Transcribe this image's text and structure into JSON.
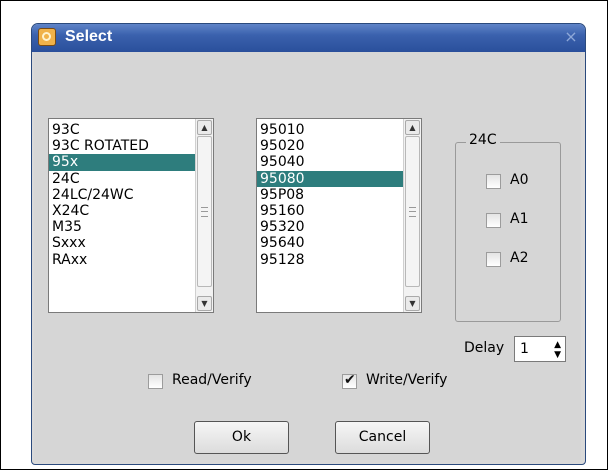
{
  "window": {
    "title": "Select",
    "close_symbol": "×"
  },
  "list_left": {
    "items": [
      "93C",
      "93C ROTATED",
      "95x",
      "24C",
      "24LC/24WC",
      "X24C",
      "M35",
      "Sxxx",
      "RAxx"
    ],
    "selected": "95x"
  },
  "list_right": {
    "items": [
      "95010",
      "95020",
      "95040",
      "95080",
      "95P08",
      "95160",
      "95320",
      "95640",
      "95128"
    ],
    "selected": "95080"
  },
  "group_24c": {
    "label": "24C",
    "checkboxes": [
      {
        "label": "A0",
        "checked": false
      },
      {
        "label": "A1",
        "checked": false
      },
      {
        "label": "A2",
        "checked": false
      }
    ]
  },
  "delay": {
    "label": "Delay",
    "value": "1",
    "up_symbol": "▲",
    "down_symbol": "▼"
  },
  "read_verify": {
    "label": "Read/Verify",
    "checked": false
  },
  "write_verify": {
    "label": "Write/Verify",
    "checked": true
  },
  "buttons": {
    "ok": "Ok",
    "cancel": "Cancel"
  },
  "scroll_symbols": {
    "up": "▲",
    "down": "▼"
  }
}
